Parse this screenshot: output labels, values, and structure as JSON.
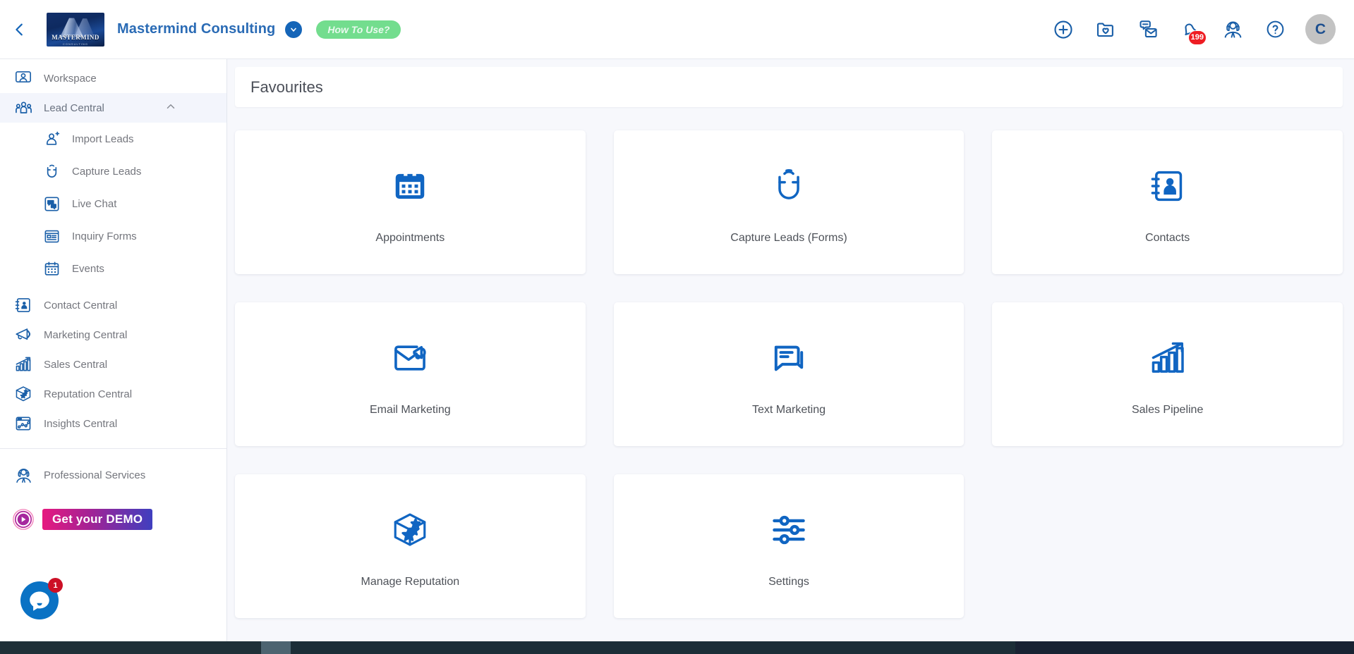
{
  "header": {
    "back_icon": "chevron-left-icon",
    "logo_text": "MASTERMIND",
    "logo_subtext": "CONSULTING",
    "company_name": "Mastermind Consulting",
    "company_dropdown_icon": "chevron-down-icon",
    "how_to_use_label": "How To Use?",
    "icons": [
      {
        "name": "add-icon",
        "title": "Add"
      },
      {
        "name": "favorites-folder-icon",
        "title": "Favourites"
      },
      {
        "name": "messages-icon",
        "title": "Messages"
      },
      {
        "name": "notifications-bell-icon",
        "title": "Notifications",
        "badge": "199"
      },
      {
        "name": "support-agent-icon",
        "title": "Support"
      },
      {
        "name": "help-icon",
        "title": "Help"
      }
    ],
    "avatar_initial": "C"
  },
  "sidebar": {
    "items": [
      {
        "label": "Workspace",
        "icon": "workspace-icon",
        "active": false
      },
      {
        "label": "Lead Central",
        "icon": "lead-central-icon",
        "active": true,
        "expanded": true
      },
      {
        "label": "Import Leads",
        "icon": "import-leads-icon",
        "sub": true
      },
      {
        "label": "Capture Leads",
        "icon": "magnet-icon",
        "sub": true
      },
      {
        "label": "Live Chat",
        "icon": "live-chat-icon",
        "sub": true
      },
      {
        "label": "Inquiry Forms",
        "icon": "inquiry-forms-icon",
        "sub": true
      },
      {
        "label": "Events",
        "icon": "calendar-icon",
        "sub": true
      },
      {
        "label": "Contact Central",
        "icon": "contact-book-icon",
        "active": false
      },
      {
        "label": "Marketing Central",
        "icon": "megaphone-icon",
        "active": false
      },
      {
        "label": "Sales Central",
        "icon": "bar-chart-arrow-icon",
        "active": false
      },
      {
        "label": "Reputation Central",
        "icon": "reputation-box-icon",
        "active": false
      },
      {
        "label": "Insights Central",
        "icon": "insights-window-icon",
        "active": false
      }
    ],
    "professional_services": {
      "label": "Professional Services",
      "icon": "support-agent-icon"
    },
    "demo": {
      "label": "Get your DEMO",
      "icon": "play-circle-icon"
    },
    "chat_widget": {
      "icon": "chat-bubble-icon",
      "badge": "1"
    }
  },
  "main": {
    "page_title": "Favourites",
    "cards": [
      {
        "label": "Appointments",
        "icon": "calendar-filled-icon"
      },
      {
        "label": "Capture Leads (Forms)",
        "icon": "magnet-icon"
      },
      {
        "label": "Contacts",
        "icon": "contact-book-icon"
      },
      {
        "label": "Email Marketing",
        "icon": "email-megaphone-icon"
      },
      {
        "label": "Text Marketing",
        "icon": "chat-messages-icon"
      },
      {
        "label": "Sales Pipeline",
        "icon": "bar-chart-arrow-icon"
      },
      {
        "label": "Manage Reputation",
        "icon": "reputation-box-icon"
      },
      {
        "label": "Settings",
        "icon": "sliders-icon"
      }
    ]
  },
  "colors": {
    "brand_blue": "#1565b8",
    "icon_blue": "#1a5fa8",
    "accent_green": "#73dd8e",
    "badge_red": "#ee1d23",
    "sidebar_text": "#74767d",
    "page_bg": "#f7f8fc"
  }
}
